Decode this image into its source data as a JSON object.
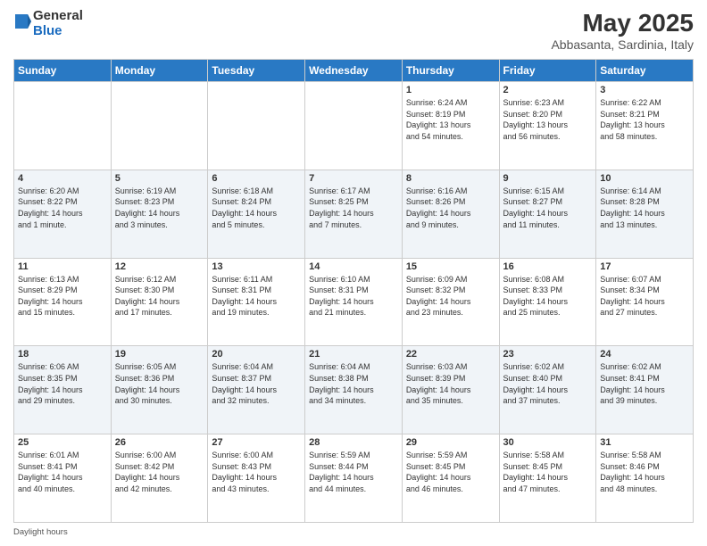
{
  "logo": {
    "general": "General",
    "blue": "Blue"
  },
  "title": "May 2025",
  "subtitle": "Abbasanta, Sardinia, Italy",
  "days_header": [
    "Sunday",
    "Monday",
    "Tuesday",
    "Wednesday",
    "Thursday",
    "Friday",
    "Saturday"
  ],
  "weeks": [
    [
      {
        "day": "",
        "info": ""
      },
      {
        "day": "",
        "info": ""
      },
      {
        "day": "",
        "info": ""
      },
      {
        "day": "",
        "info": ""
      },
      {
        "day": "1",
        "info": "Sunrise: 6:24 AM\nSunset: 8:19 PM\nDaylight: 13 hours\nand 54 minutes."
      },
      {
        "day": "2",
        "info": "Sunrise: 6:23 AM\nSunset: 8:20 PM\nDaylight: 13 hours\nand 56 minutes."
      },
      {
        "day": "3",
        "info": "Sunrise: 6:22 AM\nSunset: 8:21 PM\nDaylight: 13 hours\nand 58 minutes."
      }
    ],
    [
      {
        "day": "4",
        "info": "Sunrise: 6:20 AM\nSunset: 8:22 PM\nDaylight: 14 hours\nand 1 minute."
      },
      {
        "day": "5",
        "info": "Sunrise: 6:19 AM\nSunset: 8:23 PM\nDaylight: 14 hours\nand 3 minutes."
      },
      {
        "day": "6",
        "info": "Sunrise: 6:18 AM\nSunset: 8:24 PM\nDaylight: 14 hours\nand 5 minutes."
      },
      {
        "day": "7",
        "info": "Sunrise: 6:17 AM\nSunset: 8:25 PM\nDaylight: 14 hours\nand 7 minutes."
      },
      {
        "day": "8",
        "info": "Sunrise: 6:16 AM\nSunset: 8:26 PM\nDaylight: 14 hours\nand 9 minutes."
      },
      {
        "day": "9",
        "info": "Sunrise: 6:15 AM\nSunset: 8:27 PM\nDaylight: 14 hours\nand 11 minutes."
      },
      {
        "day": "10",
        "info": "Sunrise: 6:14 AM\nSunset: 8:28 PM\nDaylight: 14 hours\nand 13 minutes."
      }
    ],
    [
      {
        "day": "11",
        "info": "Sunrise: 6:13 AM\nSunset: 8:29 PM\nDaylight: 14 hours\nand 15 minutes."
      },
      {
        "day": "12",
        "info": "Sunrise: 6:12 AM\nSunset: 8:30 PM\nDaylight: 14 hours\nand 17 minutes."
      },
      {
        "day": "13",
        "info": "Sunrise: 6:11 AM\nSunset: 8:31 PM\nDaylight: 14 hours\nand 19 minutes."
      },
      {
        "day": "14",
        "info": "Sunrise: 6:10 AM\nSunset: 8:31 PM\nDaylight: 14 hours\nand 21 minutes."
      },
      {
        "day": "15",
        "info": "Sunrise: 6:09 AM\nSunset: 8:32 PM\nDaylight: 14 hours\nand 23 minutes."
      },
      {
        "day": "16",
        "info": "Sunrise: 6:08 AM\nSunset: 8:33 PM\nDaylight: 14 hours\nand 25 minutes."
      },
      {
        "day": "17",
        "info": "Sunrise: 6:07 AM\nSunset: 8:34 PM\nDaylight: 14 hours\nand 27 minutes."
      }
    ],
    [
      {
        "day": "18",
        "info": "Sunrise: 6:06 AM\nSunset: 8:35 PM\nDaylight: 14 hours\nand 29 minutes."
      },
      {
        "day": "19",
        "info": "Sunrise: 6:05 AM\nSunset: 8:36 PM\nDaylight: 14 hours\nand 30 minutes."
      },
      {
        "day": "20",
        "info": "Sunrise: 6:04 AM\nSunset: 8:37 PM\nDaylight: 14 hours\nand 32 minutes."
      },
      {
        "day": "21",
        "info": "Sunrise: 6:04 AM\nSunset: 8:38 PM\nDaylight: 14 hours\nand 34 minutes."
      },
      {
        "day": "22",
        "info": "Sunrise: 6:03 AM\nSunset: 8:39 PM\nDaylight: 14 hours\nand 35 minutes."
      },
      {
        "day": "23",
        "info": "Sunrise: 6:02 AM\nSunset: 8:40 PM\nDaylight: 14 hours\nand 37 minutes."
      },
      {
        "day": "24",
        "info": "Sunrise: 6:02 AM\nSunset: 8:41 PM\nDaylight: 14 hours\nand 39 minutes."
      }
    ],
    [
      {
        "day": "25",
        "info": "Sunrise: 6:01 AM\nSunset: 8:41 PM\nDaylight: 14 hours\nand 40 minutes."
      },
      {
        "day": "26",
        "info": "Sunrise: 6:00 AM\nSunset: 8:42 PM\nDaylight: 14 hours\nand 42 minutes."
      },
      {
        "day": "27",
        "info": "Sunrise: 6:00 AM\nSunset: 8:43 PM\nDaylight: 14 hours\nand 43 minutes."
      },
      {
        "day": "28",
        "info": "Sunrise: 5:59 AM\nSunset: 8:44 PM\nDaylight: 14 hours\nand 44 minutes."
      },
      {
        "day": "29",
        "info": "Sunrise: 5:59 AM\nSunset: 8:45 PM\nDaylight: 14 hours\nand 46 minutes."
      },
      {
        "day": "30",
        "info": "Sunrise: 5:58 AM\nSunset: 8:45 PM\nDaylight: 14 hours\nand 47 minutes."
      },
      {
        "day": "31",
        "info": "Sunrise: 5:58 AM\nSunset: 8:46 PM\nDaylight: 14 hours\nand 48 minutes."
      }
    ]
  ],
  "footer": "Daylight hours"
}
